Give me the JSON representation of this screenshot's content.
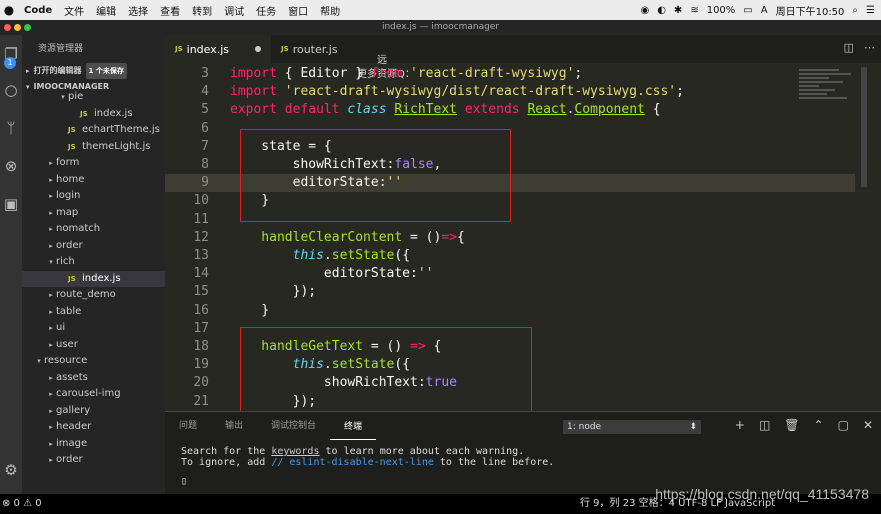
{
  "menubar": {
    "apple": "",
    "items": [
      "Code",
      "文件",
      "编辑",
      "选择",
      "查看",
      "转到",
      "调试",
      "任务",
      "窗口",
      "帮助"
    ],
    "status": {
      "battery": "100%",
      "datetime": "周日下午10:50"
    }
  },
  "window": {
    "title": "index.js — imoocmanager"
  },
  "activity": {
    "badge": "1"
  },
  "sidebar": {
    "title": "资源管理器",
    "open_editors": "打开的编辑器",
    "unsaved": "1 个未保存",
    "project": "IMOOCMANAGER",
    "tree": [
      {
        "indent": 3,
        "twisty": "▾",
        "label": "pie",
        "js": false
      },
      {
        "indent": 4,
        "twisty": "",
        "label": "index.js",
        "js": true
      },
      {
        "indent": 3,
        "twisty": "",
        "label": "echartTheme.js",
        "js": true
      },
      {
        "indent": 3,
        "twisty": "",
        "label": "themeLight.js",
        "js": true
      },
      {
        "indent": 2,
        "twisty": "▸",
        "label": "form",
        "js": false
      },
      {
        "indent": 2,
        "twisty": "▸",
        "label": "home",
        "js": false
      },
      {
        "indent": 2,
        "twisty": "▸",
        "label": "login",
        "js": false
      },
      {
        "indent": 2,
        "twisty": "▸",
        "label": "map",
        "js": false
      },
      {
        "indent": 2,
        "twisty": "▸",
        "label": "nomatch",
        "js": false
      },
      {
        "indent": 2,
        "twisty": "▸",
        "label": "order",
        "js": false
      },
      {
        "indent": 2,
        "twisty": "▾",
        "label": "rich",
        "js": false
      },
      {
        "indent": 3,
        "twisty": "",
        "label": "index.js",
        "js": true,
        "active": true
      },
      {
        "indent": 2,
        "twisty": "▸",
        "label": "route_demo",
        "js": false
      },
      {
        "indent": 2,
        "twisty": "▸",
        "label": "table",
        "js": false
      },
      {
        "indent": 2,
        "twisty": "▸",
        "label": "ui",
        "js": false
      },
      {
        "indent": 2,
        "twisty": "▸",
        "label": "user",
        "js": false
      },
      {
        "indent": 1,
        "twisty": "▾",
        "label": "resource",
        "js": false
      },
      {
        "indent": 2,
        "twisty": "▸",
        "label": "assets",
        "js": false
      },
      {
        "indent": 2,
        "twisty": "▸",
        "label": "carousel-img",
        "js": false
      },
      {
        "indent": 2,
        "twisty": "▸",
        "label": "gallery",
        "js": false
      },
      {
        "indent": 2,
        "twisty": "▸",
        "label": "header",
        "js": false
      },
      {
        "indent": 2,
        "twisty": "▸",
        "label": "image",
        "js": false
      },
      {
        "indent": 2,
        "twisty": "▸",
        "label": "order",
        "js": false
      }
    ]
  },
  "tabs": [
    {
      "label": "index.js",
      "active": true,
      "dirty": true
    },
    {
      "label": "router.js",
      "active": false,
      "dirty": false
    }
  ],
  "overlay": {
    "line1": "远",
    "line2": "更多资源Q："
  },
  "code_lines": [
    {
      "n": "3",
      "tokens": [
        [
          "kw",
          "import"
        ],
        [
          "pl",
          " { Editor } "
        ],
        [
          "kw",
          "from"
        ],
        [
          "pl",
          " "
        ],
        [
          "str",
          "'react-draft-wysiwyg'"
        ],
        [
          "pl",
          ";"
        ]
      ]
    },
    {
      "n": "4",
      "tokens": [
        [
          "kw",
          "import"
        ],
        [
          "pl",
          " "
        ],
        [
          "str",
          "'react-draft-wysiwyg/dist/react-draft-wysiwyg.css'"
        ],
        [
          "pl",
          ";"
        ]
      ]
    },
    {
      "n": "5",
      "tokens": [
        [
          "kw",
          "export default"
        ],
        [
          "pl",
          " "
        ],
        [
          "it",
          "class"
        ],
        [
          "pl",
          " "
        ],
        [
          "cls",
          "RichText"
        ],
        [
          "pl",
          " "
        ],
        [
          "kw",
          "extends"
        ],
        [
          "pl",
          " "
        ],
        [
          "cls",
          "React"
        ],
        [
          "pl",
          "."
        ],
        [
          "cls",
          "Component"
        ],
        [
          "pl",
          " {"
        ]
      ]
    },
    {
      "n": "6",
      "tokens": []
    },
    {
      "n": "7",
      "tokens": [
        [
          "pl",
          "    state = {"
        ]
      ]
    },
    {
      "n": "8",
      "tokens": [
        [
          "pl",
          "        showRichText:"
        ],
        [
          "bool",
          "false"
        ],
        [
          "pl",
          ","
        ]
      ]
    },
    {
      "n": "9",
      "tokens": [
        [
          "pl",
          "        editorState:"
        ],
        [
          "str",
          "''"
        ]
      ],
      "cur": true
    },
    {
      "n": "10",
      "tokens": [
        [
          "pl",
          "    }"
        ]
      ]
    },
    {
      "n": "11",
      "tokens": []
    },
    {
      "n": "12",
      "tokens": [
        [
          "fn",
          "    handleClearContent"
        ],
        [
          "pl",
          " = "
        ],
        [
          "pl",
          "()"
        ],
        [
          "kw",
          "=>"
        ],
        [
          "pl",
          "{"
        ]
      ]
    },
    {
      "n": "13",
      "tokens": [
        [
          "it",
          "        this"
        ],
        [
          "pl",
          "."
        ],
        [
          "fn",
          "setState"
        ],
        [
          "pl",
          "({"
        ]
      ]
    },
    {
      "n": "14",
      "tokens": [
        [
          "pl",
          "            editorState:"
        ],
        [
          "str",
          "''"
        ]
      ]
    },
    {
      "n": "15",
      "tokens": [
        [
          "pl",
          "        });"
        ]
      ]
    },
    {
      "n": "16",
      "tokens": [
        [
          "pl",
          "    }"
        ]
      ]
    },
    {
      "n": "17",
      "tokens": []
    },
    {
      "n": "18",
      "tokens": [
        [
          "fn",
          "    handleGetText"
        ],
        [
          "pl",
          " = () "
        ],
        [
          "kw",
          "=>"
        ],
        [
          "pl",
          " {"
        ]
      ]
    },
    {
      "n": "19",
      "tokens": [
        [
          "it",
          "        this"
        ],
        [
          "pl",
          "."
        ],
        [
          "fn",
          "setState"
        ],
        [
          "pl",
          "({"
        ]
      ]
    },
    {
      "n": "20",
      "tokens": [
        [
          "pl",
          "            showRichText:"
        ],
        [
          "bool",
          "true"
        ]
      ]
    },
    {
      "n": "21",
      "tokens": [
        [
          "pl",
          "        });"
        ]
      ]
    }
  ],
  "panel": {
    "tabs": [
      "问题",
      "输出",
      "调试控制台",
      "终端"
    ],
    "active_tab": "终端",
    "terminal_select": "1: node",
    "line1_pre": "Search for the ",
    "line1_link": "keywords",
    "line1_post": " to learn more about each warning.",
    "line2_pre": "To ignore, add ",
    "line2_comment": "// eslint-disable-next-line",
    "line2_post": " to the line before."
  },
  "statusbar": {
    "left": "⊗ 0 ⚠ 0",
    "right": "行 9，列 23   空格：4   UTF-8   LF   JavaScript"
  },
  "watermark": "https://blog.csdn.net/qq_41153478",
  "colors": {
    "red_box": "#e0201e",
    "editor_bg": "#272822"
  }
}
